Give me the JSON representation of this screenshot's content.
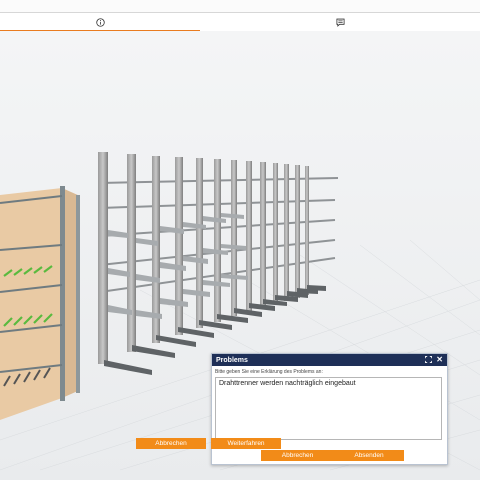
{
  "tabs": [
    {
      "name": "info",
      "icon": "info-icon"
    },
    {
      "name": "chat",
      "icon": "comment-icon"
    }
  ],
  "colors": {
    "accent": "#e97c1f",
    "button": "#f28b18",
    "dialog_header": "#1e2f57"
  },
  "dialog": {
    "title": "Problems",
    "prompt": "Bitte geben Sie eine Erklärung des Problems an:",
    "text_value": "Drahttrenner werden nachträglich eingebaut",
    "cancel_label": "Abbrechen",
    "submit_label": "Absenden",
    "maximize_icon": "maximize-icon",
    "close_icon": "close-icon",
    "close_glyph": "✕"
  },
  "footer": {
    "cancel_label": "Abbrechen",
    "continue_label": "Weiterfahren"
  }
}
